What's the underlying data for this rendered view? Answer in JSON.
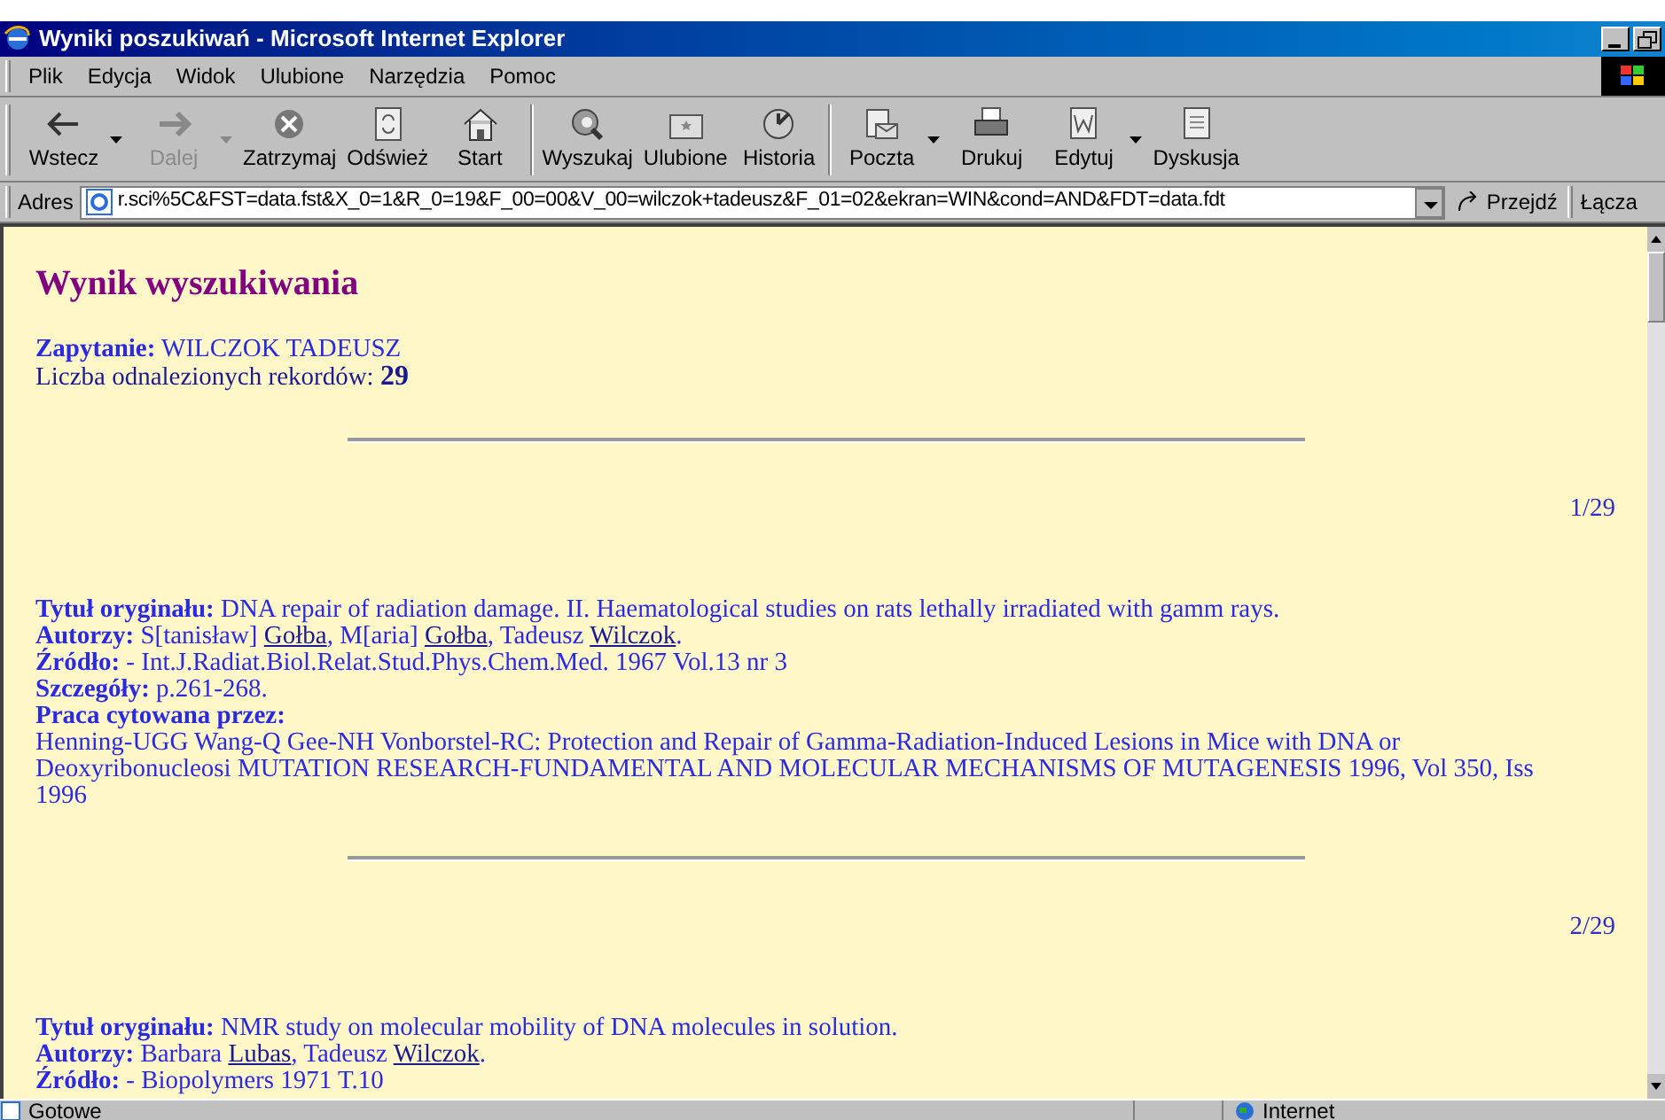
{
  "window": {
    "title": "Wyniki poszukiwań - Microsoft Internet Explorer"
  },
  "menu": [
    {
      "label": "Plik"
    },
    {
      "label": "Edycja"
    },
    {
      "label": "Widok"
    },
    {
      "label": "Ulubione"
    },
    {
      "label": "Narzędzia"
    },
    {
      "label": "Pomoc"
    }
  ],
  "toolbar": [
    {
      "label": "Wstecz",
      "disabled": false,
      "dropdown": true
    },
    {
      "label": "Dalej",
      "disabled": true,
      "dropdown": true
    },
    {
      "label": "Zatrzymaj",
      "disabled": false,
      "dropdown": false
    },
    {
      "label": "Odśwież",
      "disabled": false,
      "dropdown": false
    },
    {
      "label": "Start",
      "disabled": false,
      "dropdown": false
    },
    {
      "label": "Wyszukaj",
      "disabled": false,
      "dropdown": false
    },
    {
      "label": "Ulubione",
      "disabled": false,
      "dropdown": false
    },
    {
      "label": "Historia",
      "disabled": false,
      "dropdown": false
    },
    {
      "label": "Poczta",
      "disabled": false,
      "dropdown": true
    },
    {
      "label": "Drukuj",
      "disabled": false,
      "dropdown": false
    },
    {
      "label": "Edytuj",
      "disabled": false,
      "dropdown": true
    },
    {
      "label": "Dyskusja",
      "disabled": false,
      "dropdown": false
    }
  ],
  "address_bar": {
    "label": "Adres",
    "value": "r.sci%5C&FST=data.fst&X_0=1&R_0=19&F_00=00&V_00=wilczok+tadeusz&F_01=02&ekran=WIN&cond=AND&FDT=data.fdt",
    "go": "Przejdź",
    "links": "Łącza"
  },
  "page": {
    "heading": "Wynik wyszukiwania",
    "query_label": "Zapytanie:",
    "query": "WILCZOK TADEUSZ",
    "count_label": "Liczba odnalezionych rekordów:",
    "count": "29",
    "records": [
      {
        "position": "1/29",
        "fields": [
          {
            "kind": "text",
            "label": "Tytuł oryginału:",
            "value": "DNA repair of radiation damage. II. Haematological studies on rats lethally irradiated with gamm rays."
          },
          {
            "kind": "authors",
            "label": "Autorzy:",
            "authors": [
              {
                "given": "S[tanisław] ",
                "surname": "Gołba",
                "after": ", "
              },
              {
                "given": "M[aria] ",
                "surname": "Gołba",
                "after": ", "
              },
              {
                "given": "Tadeusz ",
                "surname": "Wilczok",
                "after": "."
              }
            ]
          },
          {
            "kind": "text",
            "label": "Źródło:",
            "value": "- Int.J.Radiat.Biol.Relat.Stud.Phys.Chem.Med. 1967 Vol.13 nr 3"
          },
          {
            "kind": "text",
            "label": "Szczegóły:",
            "value": "p.261-268."
          },
          {
            "kind": "block",
            "label": "Praca cytowana przez:",
            "value": "Henning-UGG Wang-Q Gee-NH Vonborstel-RC: Protection and Repair of Gamma-Radiation-Induced Lesions in Mice with DNA or Deoxyribonucleosi MUTATION RESEARCH-FUNDAMENTAL AND MOLECULAR MECHANISMS OF MUTAGENESIS 1996, Vol 350, Iss 1996"
          }
        ]
      },
      {
        "position": "2/29",
        "fields": [
          {
            "kind": "text",
            "label": "Tytuł oryginału:",
            "value": "NMR study on molecular mobility of DNA molecules in solution."
          },
          {
            "kind": "authors",
            "label": "Autorzy:",
            "authors": [
              {
                "given": "Barbara ",
                "surname": "Lubas",
                "after": ", "
              },
              {
                "given": "Tadeusz ",
                "surname": "Wilczok",
                "after": "."
              }
            ]
          },
          {
            "kind": "text",
            "label": "Źródło:",
            "value": "- Biopolymers 1971 T.10"
          }
        ]
      }
    ]
  },
  "status_bar": {
    "text": "Gotowe",
    "zone": "Internet"
  }
}
